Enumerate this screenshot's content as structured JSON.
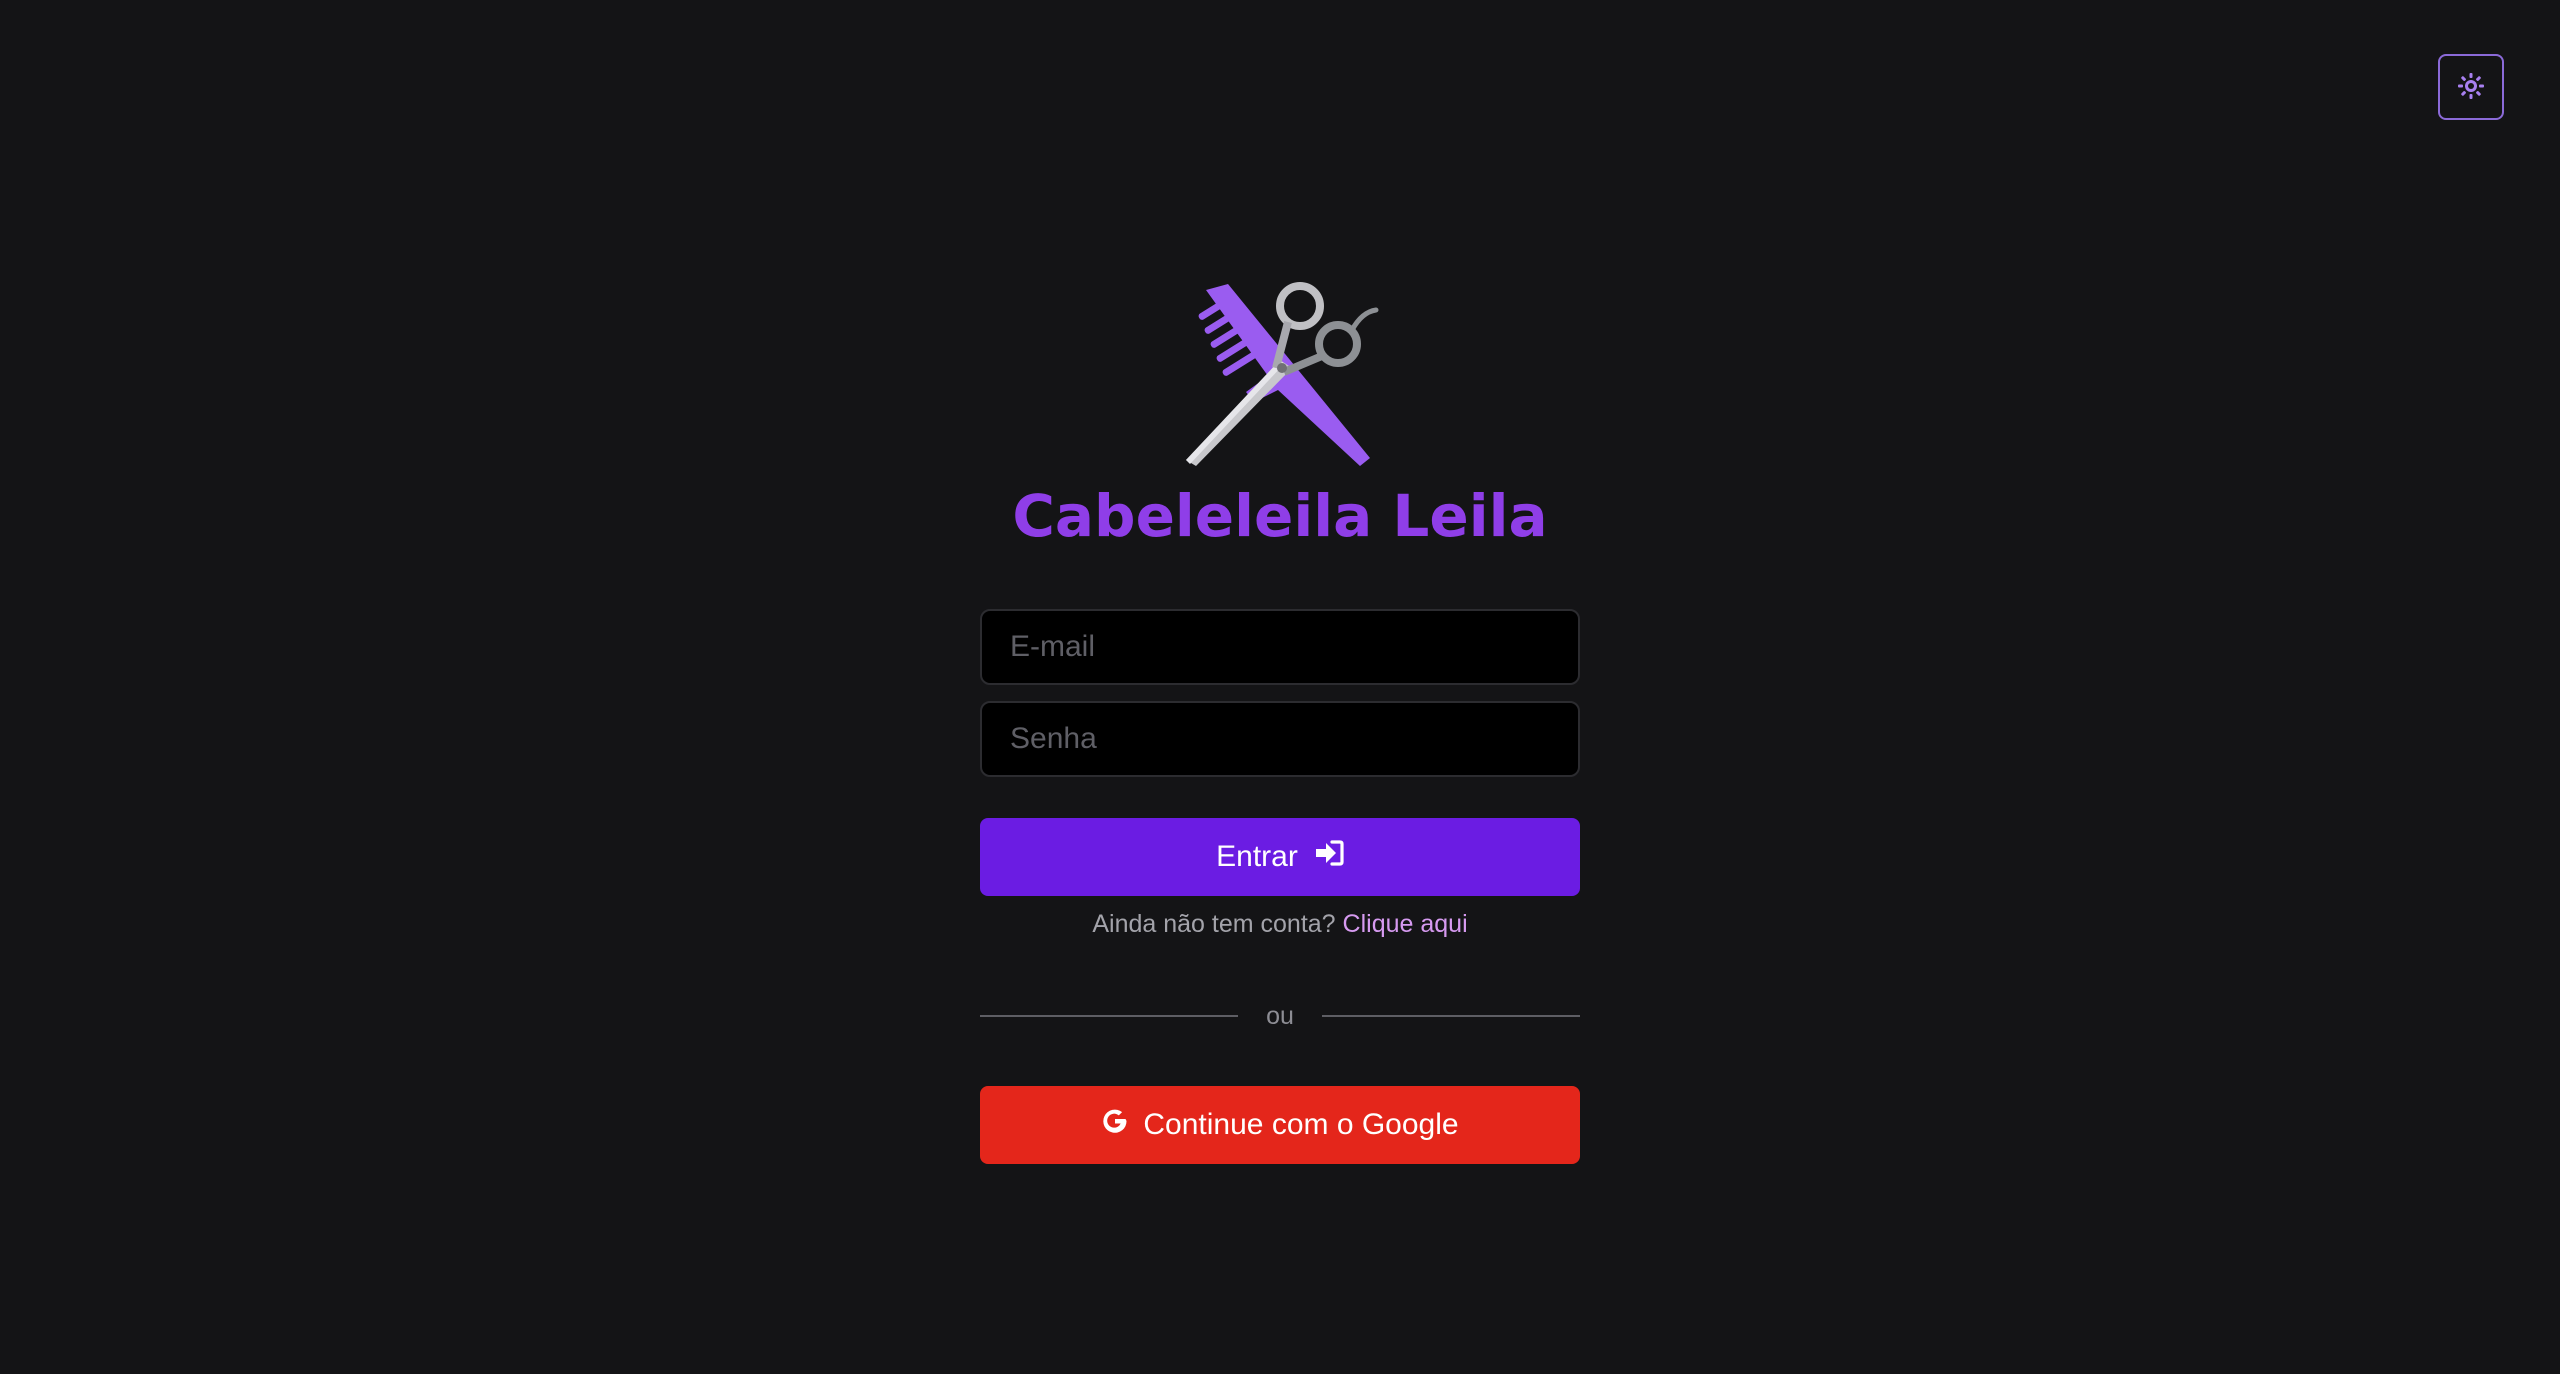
{
  "header": {
    "theme_toggle_icon": "sun-icon",
    "accent_color": "#8b6ad8"
  },
  "brand": {
    "logo_icon": "comb-and-scissors-icon",
    "title": "Cabeleleila Leila",
    "color": "#8f3ee8"
  },
  "form": {
    "email_placeholder": "E-mail",
    "password_placeholder": "Senha",
    "login_label": "Entrar",
    "login_icon": "sign-in-icon",
    "login_color": "#6b1ce3"
  },
  "signup": {
    "prompt": "Ainda não tem conta?",
    "link_label": "Clique aqui"
  },
  "divider": {
    "label": "ou"
  },
  "google": {
    "label": "Continue com o Google",
    "icon": "google-icon",
    "color": "#e4261b"
  }
}
